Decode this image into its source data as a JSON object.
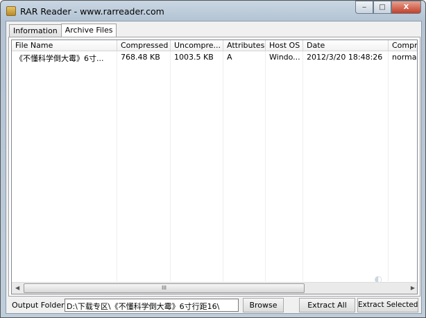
{
  "window": {
    "title": "RAR Reader - www.rarreader.com",
    "controls": {
      "minimize": "‒",
      "maximize": "□",
      "close": "X"
    }
  },
  "tabs": [
    {
      "label": "Information"
    },
    {
      "label": "Archive Files"
    }
  ],
  "columns": [
    "File Name",
    "Compressed",
    "Uncompre...",
    "Attributes",
    "Host OS",
    "Date",
    "Compres"
  ],
  "rows": [
    [
      "《不懂科学倒大霉》6寸...",
      "768.48 KB",
      "1003.5 KB",
      "A",
      "Windo...",
      "2012/3/20 18:48:26",
      "normal"
    ]
  ],
  "scrollbar": {
    "grip": "III"
  },
  "bottom": {
    "output_label": "Output Folder:",
    "output_value": "D:\\下载专区\\《不懂科学倒大霉》6寸行距16\\",
    "browse": "Browse",
    "extract_all": "Extract All",
    "extract_selected": "Extract Selected"
  }
}
